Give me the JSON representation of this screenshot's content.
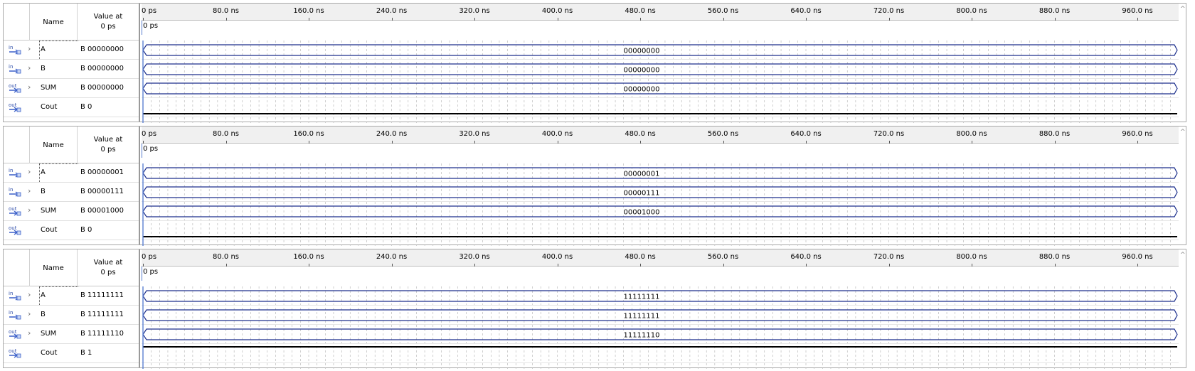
{
  "columns": {
    "name": "Name",
    "value_at_line1": "Value at",
    "value_at_line2": "0 ps"
  },
  "ruler": {
    "ticks": [
      "0 ps",
      "80.0 ns",
      "160.0 ns",
      "240.0 ns",
      "320.0 ns",
      "400.0 ns",
      "480.0 ns",
      "560.0 ns",
      "640.0 ns",
      "720.0 ns",
      "800.0 ns",
      "880.0 ns",
      "960.0 ns"
    ],
    "time_bar_label": "0 ps"
  },
  "icons": {
    "input": "input-pin-icon",
    "output": "output-pin-icon",
    "expand": "chevron-right-icon"
  },
  "colors": {
    "bus": "#1c2f8c",
    "low_line": "#000000",
    "grid": "#b0b0b0",
    "time_bar": "#5a7fd1"
  },
  "panels": [
    {
      "signals": [
        {
          "name": "A",
          "kind": "in",
          "bus": true,
          "value": "B 00000000",
          "wave_text": "00000000"
        },
        {
          "name": "B",
          "kind": "in",
          "bus": true,
          "value": "B 00000000",
          "wave_text": "00000000"
        },
        {
          "name": "SUM",
          "kind": "out",
          "bus": true,
          "value": "B 00000000",
          "wave_text": "00000000"
        },
        {
          "name": "Cout",
          "kind": "out",
          "bus": false,
          "value": "B 0",
          "level": 0
        }
      ]
    },
    {
      "signals": [
        {
          "name": "A",
          "kind": "in",
          "bus": true,
          "value": "B 00000001",
          "wave_text": "00000001"
        },
        {
          "name": "B",
          "kind": "in",
          "bus": true,
          "value": "B 00000111",
          "wave_text": "00000111"
        },
        {
          "name": "SUM",
          "kind": "out",
          "bus": true,
          "value": "B 00001000",
          "wave_text": "00001000"
        },
        {
          "name": "Cout",
          "kind": "out",
          "bus": false,
          "value": "B 0",
          "level": 0
        }
      ]
    },
    {
      "signals": [
        {
          "name": "A",
          "kind": "in",
          "bus": true,
          "value": "B 11111111",
          "wave_text": "11111111"
        },
        {
          "name": "B",
          "kind": "in",
          "bus": true,
          "value": "B 11111111",
          "wave_text": "11111111"
        },
        {
          "name": "SUM",
          "kind": "out",
          "bus": true,
          "value": "B 11111110",
          "wave_text": "11111110"
        },
        {
          "name": "Cout",
          "kind": "out",
          "bus": false,
          "value": "B 1",
          "level": 1
        }
      ]
    }
  ]
}
